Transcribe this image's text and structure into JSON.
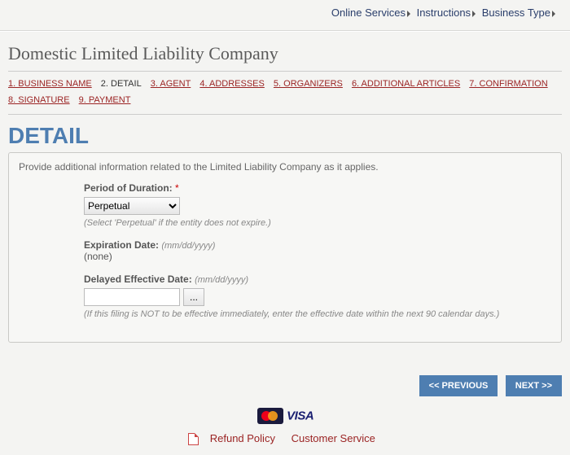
{
  "top_nav": {
    "online_services": "Online Services",
    "instructions": "Instructions",
    "business_type": "Business Type"
  },
  "page_title": "Domestic Limited Liability Company",
  "steps": [
    {
      "num": "1",
      "label": "BUSINESS NAME",
      "current": false
    },
    {
      "num": "2",
      "label": "DETAIL",
      "current": true
    },
    {
      "num": "3",
      "label": "AGENT",
      "current": false
    },
    {
      "num": "4",
      "label": "ADDRESSES",
      "current": false
    },
    {
      "num": "5",
      "label": "ORGANIZERS",
      "current": false
    },
    {
      "num": "6",
      "label": "ADDITIONAL ARTICLES",
      "current": false
    },
    {
      "num": "7",
      "label": "CONFIRMATION",
      "current": false
    },
    {
      "num": "8",
      "label": "SIGNATURE",
      "current": false
    },
    {
      "num": "9",
      "label": "PAYMENT",
      "current": false
    }
  ],
  "section_heading": "DETAIL",
  "intro": "Provide additional information related to the Limited Liability Company as it applies.",
  "form": {
    "duration": {
      "label": "Period of Duration:",
      "required_mark": "*",
      "value": "Perpetual",
      "note": "(Select 'Perpetual' if the entity does not expire.)"
    },
    "expiration": {
      "label": "Expiration Date:",
      "hint": "(mm/dd/yyyy)",
      "value": "(none)"
    },
    "effective": {
      "label": "Delayed Effective Date:",
      "hint": "(mm/dd/yyyy)",
      "picker": "...",
      "note": "(If this filing is NOT to be effective immediately, enter the effective date within the next 90 calendar days.)"
    }
  },
  "buttons": {
    "previous": "<< PREVIOUS",
    "next": "NEXT >>"
  },
  "footer": {
    "visa": "VISA",
    "refund": "Refund Policy",
    "customer": "Customer Service"
  }
}
